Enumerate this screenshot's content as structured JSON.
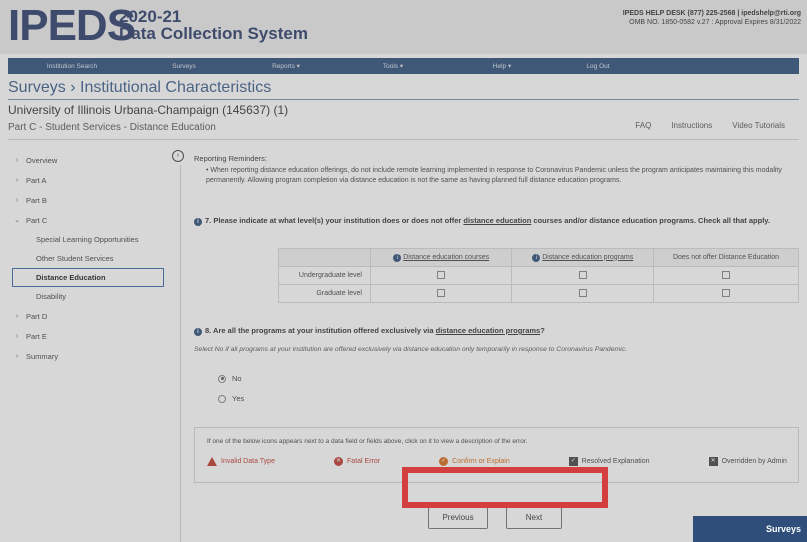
{
  "header": {
    "logo": "IPEDS",
    "year": "2020-21",
    "system": "Data Collection System",
    "helpdesk": "IPEDS HELP DESK (877) 225-2568 | ipedshelp@rti.org",
    "omb": "OMB NO. 1850-0582 v.27 : Approval Expires 8/31/2022"
  },
  "nav": [
    "Institution Search",
    "Surveys",
    "Reports ▾",
    "Tools ▾",
    "Help ▾",
    "Log Out"
  ],
  "breadcrumb": "Surveys  ›  Institutional Characteristics",
  "institution": "University of Illinois Urbana-Champaign (145637) (1)",
  "part_title": "Part C - Student Services - Distance Education",
  "toplinks": [
    "FAQ",
    "Instructions",
    "Video Tutorials"
  ],
  "sidebar": {
    "items": [
      "Overview",
      "Part A",
      "Part B",
      "Part C"
    ],
    "subitems": [
      "Special Learning Opportunities",
      "Other Student Services",
      "Distance Education",
      "Disability"
    ],
    "items_after": [
      "Part D",
      "Part E",
      "Summary"
    ]
  },
  "reminders": {
    "title": "Reporting Reminders:",
    "bullet": "When reporting distance education offerings, do not include remote learning implemented in response to Coronavirus Pandemic unless the program anticipates maintaining this modality permanently. Allowing program completion via distance education is not the same as having planned full distance education programs."
  },
  "q7": {
    "prefix": "7. Please indicate at what level(s) your institution does or does not offer ",
    "link": "distance education",
    "suffix": " courses and/or distance education programs. Check all that apply.",
    "cols": [
      "Distance education courses",
      "Distance education programs",
      "Does not offer Distance Education"
    ],
    "rows": [
      "Undergraduate level",
      "Graduate level"
    ]
  },
  "q8": {
    "prefix": "8. Are all the programs at your institution offered exclusively via ",
    "link": "distance education programs",
    "suffix": "?",
    "note": "Select No if all programs at your institution are offered exclusively via distance education only temporarily in response to Coronavirus Pandemic.",
    "options": [
      "No",
      "Yes"
    ],
    "selected": "No"
  },
  "legend": {
    "note": "If one of the below icons appears next to a data field or fields above, click on it to view a description of the error.",
    "items": [
      "Invalid Data Type",
      "Fatal Error",
      "Confirm or Explain",
      "Resolved Explanation",
      "Overridden by Admin"
    ]
  },
  "buttons": {
    "previous": "Previous",
    "next": "Next"
  },
  "corner_label": "Surveys"
}
